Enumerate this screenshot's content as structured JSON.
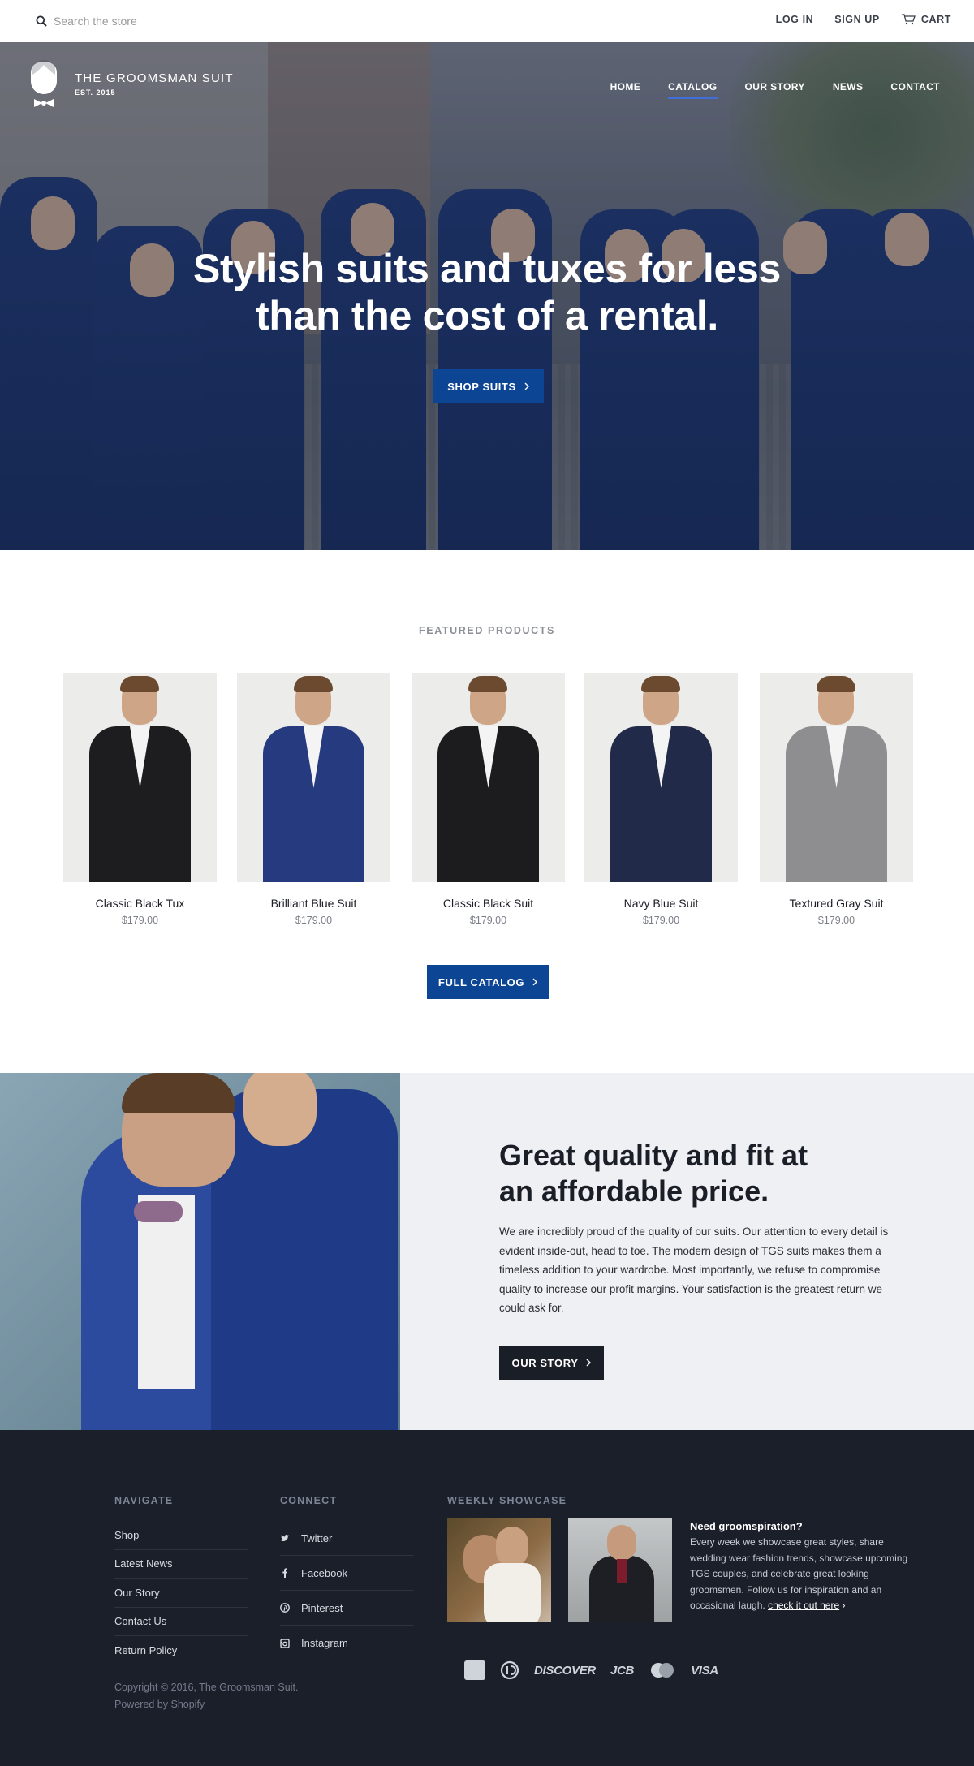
{
  "search": {
    "placeholder": "Search the store"
  },
  "account": {
    "login": "LOG IN",
    "signup": "SIGN UP",
    "cart": "CART"
  },
  "brand": {
    "name": "THE GROOMSMAN SUIT",
    "est": "EST. 2015"
  },
  "nav": [
    {
      "label": "HOME",
      "active": false
    },
    {
      "label": "CATALOG",
      "active": true
    },
    {
      "label": "OUR STORY",
      "active": false
    },
    {
      "label": "NEWS",
      "active": false
    },
    {
      "label": "CONTACT",
      "active": false
    }
  ],
  "hero": {
    "headline_line1": "Stylish suits and tuxes for less",
    "headline_line2": "than the cost of a rental.",
    "cta": "SHOP SUITS"
  },
  "featured": {
    "title": "FEATURED PRODUCTS",
    "products": [
      {
        "name": "Classic Black Tux",
        "price": "$179.00",
        "suit_color": "#1d1d1f"
      },
      {
        "name": "Brilliant Blue Suit",
        "price": "$179.00",
        "suit_color": "#263a80"
      },
      {
        "name": "Classic Black Suit",
        "price": "$179.00",
        "suit_color": "#1c1c1e"
      },
      {
        "name": "Navy Blue Suit",
        "price": "$179.00",
        "suit_color": "#222a4a"
      },
      {
        "name": "Textured Gray Suit",
        "price": "$179.00",
        "suit_color": "#8e8e90"
      }
    ],
    "cta": "FULL CATALOG"
  },
  "story": {
    "heading_line1": "Great quality and fit at",
    "heading_line2": "an affordable price.",
    "body": "We are incredibly proud of the quality of our suits. Our attention to every detail is evident inside-out, head to toe. The modern design of TGS suits makes them a timeless addition to your wardrobe. Most importantly, we refuse to compromise quality to increase our profit margins. Your satisfaction is the greatest return we could ask for.",
    "cta": "OUR STORY"
  },
  "footer": {
    "navigate": {
      "title": "NAVIGATE",
      "links": [
        "Shop",
        "Latest News",
        "Our Story",
        "Contact Us",
        "Return Policy"
      ]
    },
    "connect": {
      "title": "CONNECT",
      "links": [
        "Twitter",
        "Facebook",
        "Pinterest",
        "Instagram"
      ]
    },
    "showcase": {
      "title": "WEEKLY SHOWCASE",
      "heading": "Need groomspiration?",
      "body": "Every week we showcase great styles, share wedding wear fashion trends, showcase upcoming TGS couples, and celebrate great looking groomsmen. Follow us for inspiration and an occasional laugh.",
      "link": "check it out here"
    },
    "copyright": "Copyright © 2016, The Groomsman Suit.",
    "powered": "Powered by Shopify",
    "payments": [
      "DISCOVER",
      "JCB",
      "VISA"
    ]
  },
  "colors": {
    "accent_blue": "#0d4595",
    "footer_bg": "#1b1f2a",
    "story_bg": "#eff0f3"
  }
}
